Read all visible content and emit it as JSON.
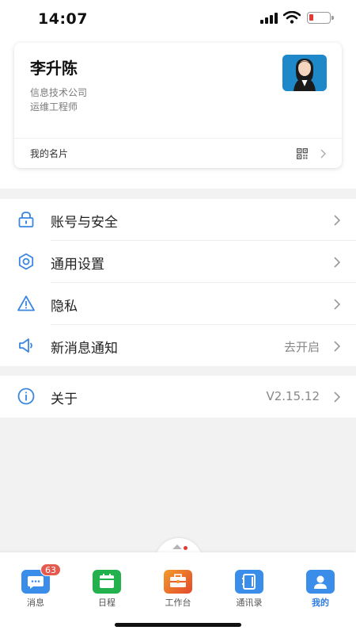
{
  "status_bar": {
    "time": "14:07",
    "icons": [
      "signal-icon",
      "wifi-icon",
      "battery-low-icon"
    ]
  },
  "profile": {
    "name": "李升陈",
    "company": "信息技术公司",
    "title": "运维工程师",
    "avatar_icon": "avatar-photo",
    "business_card_label": "我的名片",
    "business_card_icon": "qr-code-icon"
  },
  "settings": {
    "items": [
      {
        "label": "账号与安全",
        "icon": "lock-icon",
        "value": ""
      },
      {
        "label": "通用设置",
        "icon": "gear-icon",
        "value": ""
      },
      {
        "label": "隐私",
        "icon": "warning-icon",
        "value": ""
      },
      {
        "label": "新消息通知",
        "icon": "speaker-icon",
        "value": "去开启"
      }
    ],
    "about": {
      "label": "关于",
      "icon": "info-icon",
      "value": "V2.15.12"
    }
  },
  "tab_bar": {
    "tabs": [
      {
        "label": "消息",
        "icon": "message-icon",
        "badge": "63"
      },
      {
        "label": "日程",
        "icon": "calendar-icon"
      },
      {
        "label": "工作台",
        "icon": "workbench-icon"
      },
      {
        "label": "通讯录",
        "icon": "contacts-icon"
      },
      {
        "label": "我的",
        "icon": "profile-icon",
        "active": true
      }
    ]
  },
  "colors": {
    "accent": "#2f7ddf",
    "badge": "#e55a4f",
    "schedule_green": "#22b14c",
    "workbench_red": "#e24a2b",
    "background": "#f2f2f2"
  }
}
